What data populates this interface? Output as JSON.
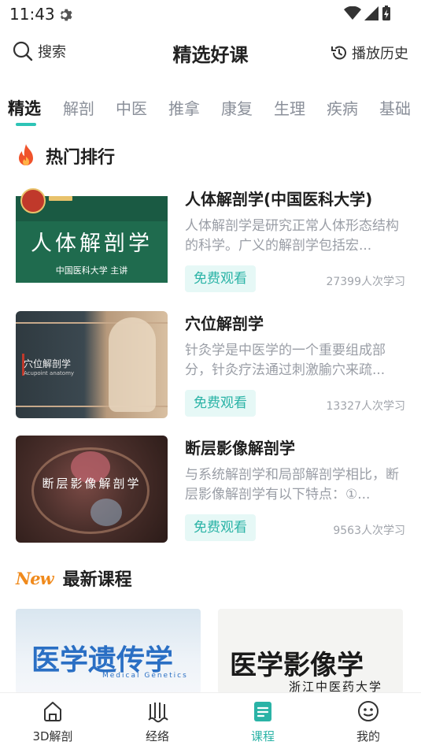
{
  "status_bar": {
    "time": "11:43"
  },
  "header": {
    "search_label": "搜索",
    "title": "精选好课",
    "history_label": "播放历史"
  },
  "tabs": [
    "精选",
    "解剖",
    "中医",
    "推拿",
    "康复",
    "生理",
    "疾病",
    "基础"
  ],
  "active_tab": "精选",
  "hot_section": {
    "title": "热门排行",
    "courses": [
      {
        "title": "人体解剖学(中国医科大学)",
        "desc": "人体解剖学是研究正常人体形态结构的科学。广义的解剖学包括宏...",
        "free_label": "免费观看",
        "learners": "27399人次学习",
        "thumb_title": "人体解剖学",
        "thumb_sub": "中国医科大学    主讲"
      },
      {
        "title": "穴位解剖学",
        "desc": "针灸学是中医学的一个重要组成部分，针灸疗法通过刺激腧穴来疏...",
        "free_label": "免费观看",
        "learners": "13327人次学习",
        "thumb_title": "穴位解剖学",
        "thumb_sub": "Acupoint anatomy"
      },
      {
        "title": "断层影像解剖学",
        "desc": "与系统解剖学和局部解剖学相比，断层影像解剖学有以下特点：①...",
        "free_label": "免费观看",
        "learners": "9563人次学习",
        "thumb_title": "断层影像解剖学"
      }
    ]
  },
  "new_section": {
    "badge": "New",
    "title": "最新课程",
    "courses": [
      {
        "thumb_title": "医学遗传学",
        "thumb_sub": "Medical Genetics"
      },
      {
        "thumb_title": "医学影像学",
        "thumb_sub": "浙江中医药大学"
      }
    ]
  },
  "bottom_nav": [
    {
      "label": "3D解剖",
      "icon": "home-icon"
    },
    {
      "label": "经络",
      "icon": "meridian-icon"
    },
    {
      "label": "课程",
      "icon": "course-icon"
    },
    {
      "label": "我的",
      "icon": "profile-icon"
    }
  ],
  "active_nav": "课程",
  "colors": {
    "accent": "#2ab3a6",
    "flame": "#f0532b",
    "new_badge": "#f08a1c"
  }
}
